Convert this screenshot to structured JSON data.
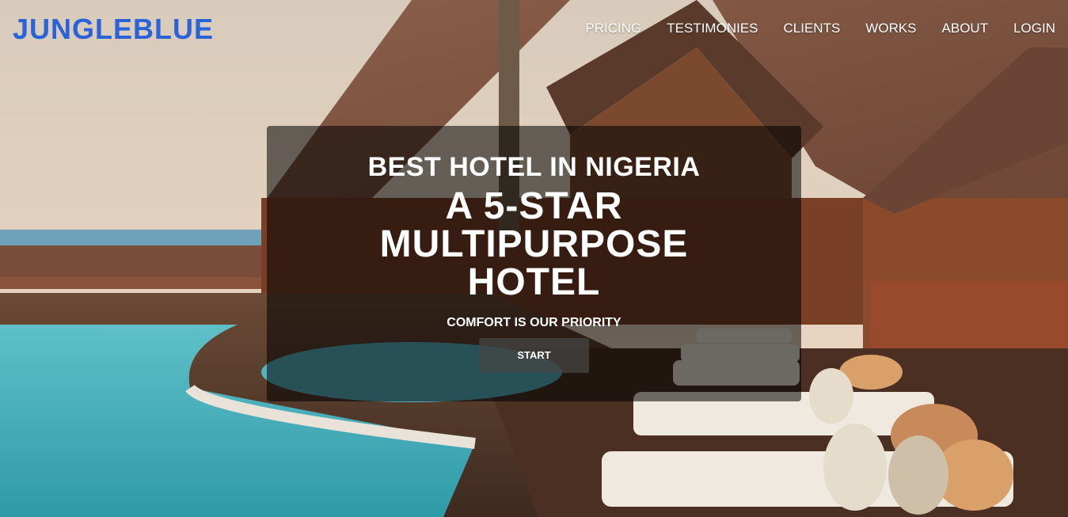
{
  "brand": {
    "name": "JUNGLEBLUE",
    "color": "#2a62d8"
  },
  "nav": {
    "items": [
      "PRICING",
      "TESTIMONIES",
      "CLIENTS",
      "WORKS",
      "ABOUT",
      "LOGIN"
    ]
  },
  "hero": {
    "kicker": "BEST HOTEL IN NIGERIA",
    "headline": "A 5-STAR MULTIPURPOSE HOTEL",
    "tagline": "COMFORT IS OUR PRIORITY",
    "cta_label": "START",
    "background_image": "hotel-poolside-photo"
  }
}
